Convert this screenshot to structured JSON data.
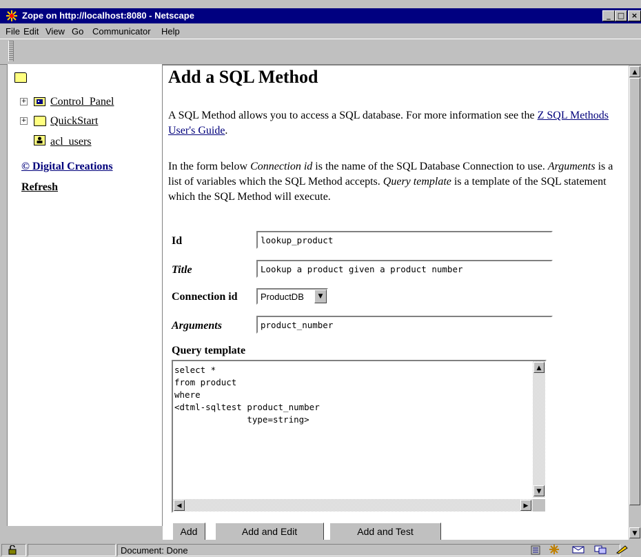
{
  "window": {
    "title": "Zope on http://localhost:8080 - Netscape",
    "min": "_",
    "max": "□",
    "close": "×"
  },
  "menu": [
    "File",
    "Edit",
    "View",
    "Go",
    "Communicator",
    "Help"
  ],
  "tree": {
    "items": [
      {
        "label": "Control_Panel"
      },
      {
        "label": "QuickStart"
      },
      {
        "label": "acl_users"
      }
    ],
    "copyright": "© Digital Creations",
    "refresh": "Refresh",
    "expand": "+"
  },
  "main": {
    "heading": "Add a SQL Method",
    "intro_before": "A SQL Method allows you to access a SQL database. For more information see the ",
    "intro_link": "Z SQL Methods User's Guide",
    "intro_after": ".",
    "p2_a": "In the form below ",
    "p2_b": "Connection id",
    "p2_c": " is the name of the SQL Database Connection to use. ",
    "p2_d": "Arguments",
    "p2_e": " is a list of variables which the SQL Method accepts. ",
    "p2_f": "Query template",
    "p2_g": " is a template of the SQL statement which the SQL Method will execute."
  },
  "form": {
    "id_label": "Id",
    "id_value": "lookup_product",
    "title_label": "Title",
    "title_value": "Lookup a product given a product number",
    "connection_label": "Connection id",
    "connection_value": "ProductDB",
    "arguments_label": "Arguments",
    "arguments_value": "product_number",
    "query_label": "Query template",
    "query_value": "select *\nfrom product\nwhere\n<dtml-sqltest product_number\n              type=string>",
    "buttons": {
      "add": "Add",
      "add_edit": "Add and Edit",
      "add_test": "Add and Test"
    }
  },
  "status": {
    "text": "Document: Done"
  },
  "colors": {
    "titlebar": "#000080",
    "link": "#00007b",
    "chrome": "#c0c0c0"
  }
}
